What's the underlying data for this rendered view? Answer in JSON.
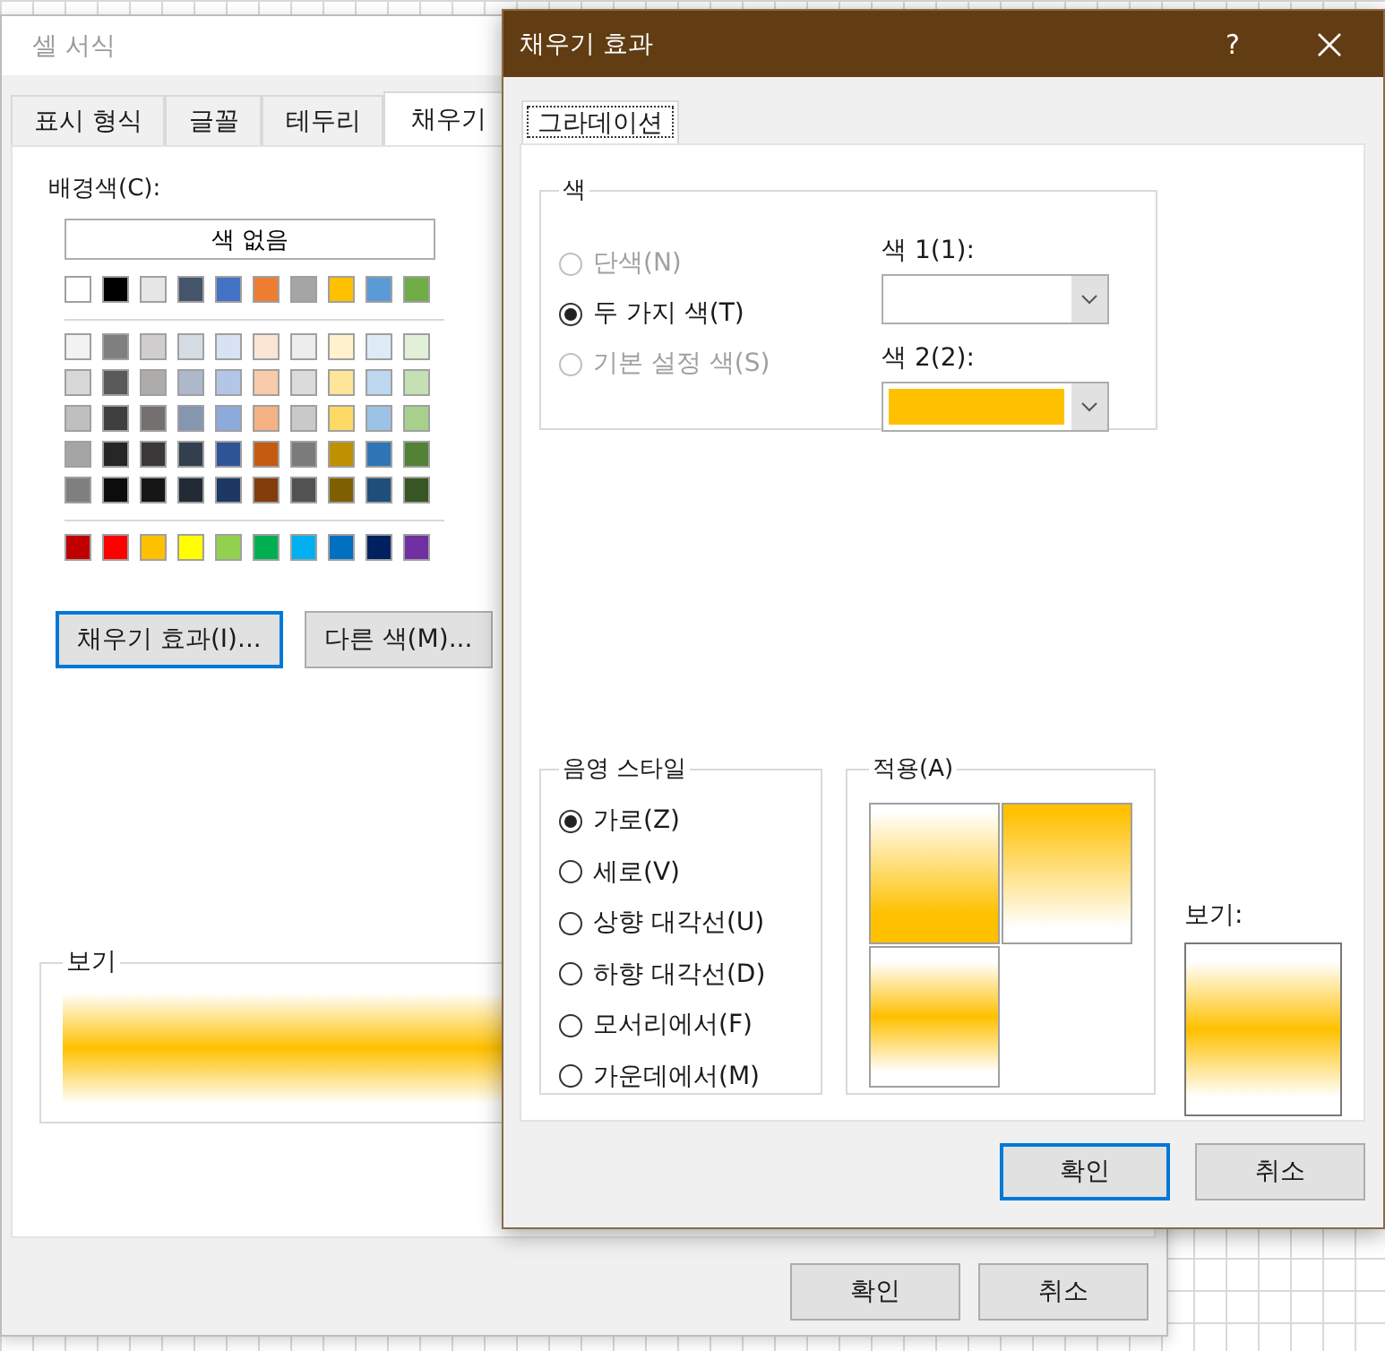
{
  "background_dialog": {
    "title": "셀 서식",
    "tabs": [
      {
        "label": "표시 형식",
        "selected": false
      },
      {
        "label": "글꼴",
        "selected": false
      },
      {
        "label": "테두리",
        "selected": false
      },
      {
        "label": "채우기",
        "selected": true
      }
    ],
    "background_color_label": "배경색(C):",
    "no_color_button": "색 없음",
    "palette_groups": [
      {
        "rows": [
          {
            "swatches": [
              {
                "color": "#ffffff"
              },
              {
                "color": "#000000"
              },
              {
                "color": "#e7e6e6"
              },
              {
                "color": "#44546a"
              },
              {
                "color": "#4472c4"
              },
              {
                "color": "#ed7d31"
              },
              {
                "color": "#a5a5a5"
              },
              {
                "color": "#ffc000"
              },
              {
                "color": "#5b9bd5"
              },
              {
                "color": "#70ad47"
              }
            ]
          }
        ]
      },
      {
        "rows": [
          {
            "swatches": [
              {
                "color": "#f2f2f2"
              },
              {
                "color": "#7f7f7f"
              },
              {
                "color": "#d0cece"
              },
              {
                "color": "#d6dce4"
              },
              {
                "color": "#d9e2f3"
              },
              {
                "color": "#fbe5d5"
              },
              {
                "color": "#ededed"
              },
              {
                "color": "#fff2cc"
              },
              {
                "color": "#deebf6"
              },
              {
                "color": "#e2efd9"
              }
            ]
          },
          {
            "swatches": [
              {
                "color": "#d8d8d8"
              },
              {
                "color": "#595959"
              },
              {
                "color": "#aeabab"
              },
              {
                "color": "#adb9ca"
              },
              {
                "color": "#b4c6e7"
              },
              {
                "color": "#f7cbac"
              },
              {
                "color": "#dbdbdb"
              },
              {
                "color": "#fee599"
              },
              {
                "color": "#bdd7ee"
              },
              {
                "color": "#c5e0b3"
              }
            ]
          },
          {
            "swatches": [
              {
                "color": "#bfbfbf"
              },
              {
                "color": "#3f3f3f"
              },
              {
                "color": "#757070"
              },
              {
                "color": "#8496b0"
              },
              {
                "color": "#8eaadb"
              },
              {
                "color": "#f4b183"
              },
              {
                "color": "#c9c9c9"
              },
              {
                "color": "#ffd965"
              },
              {
                "color": "#9cc3e5"
              },
              {
                "color": "#a8d08d"
              }
            ]
          },
          {
            "swatches": [
              {
                "color": "#a5a5a5"
              },
              {
                "color": "#262626"
              },
              {
                "color": "#3a3838"
              },
              {
                "color": "#323f4f"
              },
              {
                "color": "#2f5496"
              },
              {
                "color": "#c55a11"
              },
              {
                "color": "#7b7b7b"
              },
              {
                "color": "#bf9000"
              },
              {
                "color": "#2e75b5"
              },
              {
                "color": "#538135"
              }
            ]
          },
          {
            "swatches": [
              {
                "color": "#7f7f7f"
              },
              {
                "color": "#0c0c0c"
              },
              {
                "color": "#171616"
              },
              {
                "color": "#222a35"
              },
              {
                "color": "#1e3864"
              },
              {
                "color": "#833c0b"
              },
              {
                "color": "#525252"
              },
              {
                "color": "#7f6000"
              },
              {
                "color": "#1e4e79"
              },
              {
                "color": "#375623"
              }
            ]
          }
        ]
      },
      {
        "rows": [
          {
            "swatches": [
              {
                "color": "#c00000"
              },
              {
                "color": "#ff0000"
              },
              {
                "color": "#ffc000"
              },
              {
                "color": "#ffff00"
              },
              {
                "color": "#92d050"
              },
              {
                "color": "#00b050"
              },
              {
                "color": "#00b0f0"
              },
              {
                "color": "#0070c0"
              },
              {
                "color": "#002060"
              },
              {
                "color": "#7030a0"
              }
            ]
          }
        ]
      }
    ],
    "fill_effects_button": "채우기 효과(I)...",
    "more_colors_button": "다른 색(M)...",
    "sample_label": "보기",
    "ok_button": "확인",
    "cancel_button": "취소"
  },
  "fill_effects_dialog": {
    "title": "채우기 효과",
    "help_button": "?",
    "tab": {
      "label": "그라데이션",
      "selected": true
    },
    "colors_group": {
      "label": "색",
      "options": [
        {
          "label": "단색(N)",
          "selected": false,
          "disabled": true
        },
        {
          "label": "두 가지 색(T)",
          "selected": true,
          "disabled": false
        },
        {
          "label": "기본 설정 색(S)",
          "selected": false,
          "disabled": true
        }
      ],
      "pickers": [
        {
          "label": "색 1(1):",
          "color": "#ffffff"
        },
        {
          "label": "색 2(2):",
          "color": "#ffc000"
        }
      ]
    },
    "shading_group": {
      "label": "음영 스타일",
      "options": [
        {
          "label": "가로(Z)",
          "selected": true
        },
        {
          "label": "세로(V)",
          "selected": false
        },
        {
          "label": "상향 대각선(U)",
          "selected": false
        },
        {
          "label": "하향 대각선(D)",
          "selected": false
        },
        {
          "label": "모서리에서(F)",
          "selected": false
        },
        {
          "label": "가운데에서(M)",
          "selected": false
        }
      ]
    },
    "variants_group": {
      "label": "적용(A)",
      "variants": [
        {
          "kind": "fade-down"
        },
        {
          "kind": "fade-up"
        },
        {
          "kind": "center-band"
        }
      ]
    },
    "sample_label": "보기:",
    "ok_button": "확인",
    "cancel_button": "취소"
  }
}
